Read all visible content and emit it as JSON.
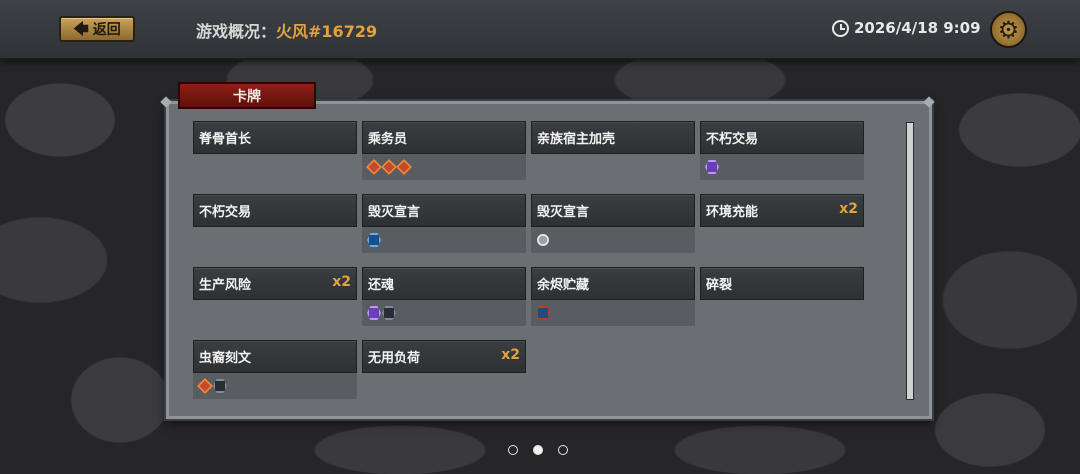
{
  "header": {
    "back_label": "返回",
    "title_prefix": "游戏概况：",
    "player": "火风#16729",
    "datetime": "2026/4/18 9:09",
    "settings_icon": "gear-icon",
    "clock_icon": "clock-icon"
  },
  "panel": {
    "tab_label": "卡牌"
  },
  "cards": [
    {
      "name": "脊骨首长",
      "count": "",
      "tags": []
    },
    {
      "name": "乘务员",
      "count": "",
      "tags": [
        "red",
        "red",
        "red"
      ]
    },
    {
      "name": "亲族宿主加壳",
      "count": "",
      "tags": []
    },
    {
      "name": "不朽交易",
      "count": "",
      "tags": [
        "purple"
      ]
    },
    {
      "name": "不朽交易",
      "count": "",
      "tags": []
    },
    {
      "name": "毁灭宣言",
      "count": "",
      "tags": [
        "blue"
      ]
    },
    {
      "name": "毁灭宣言",
      "count": "",
      "tags": [
        "white"
      ]
    },
    {
      "name": "环境充能",
      "count": "x2",
      "tags": []
    },
    {
      "name": "生产风险",
      "count": "x2",
      "tags": []
    },
    {
      "name": "还魂",
      "count": "",
      "tags": [
        "purple",
        "dark"
      ]
    },
    {
      "name": "余烬贮藏",
      "count": "",
      "tags": [
        "redblue"
      ]
    },
    {
      "name": "碎裂",
      "count": "",
      "tags": []
    },
    {
      "name": "虫裔刻文",
      "count": "",
      "tags": [
        "red",
        "dark"
      ]
    },
    {
      "name": "无用负荷",
      "count": "x2",
      "tags": []
    }
  ],
  "pager": {
    "pages": 3,
    "current": 2
  }
}
